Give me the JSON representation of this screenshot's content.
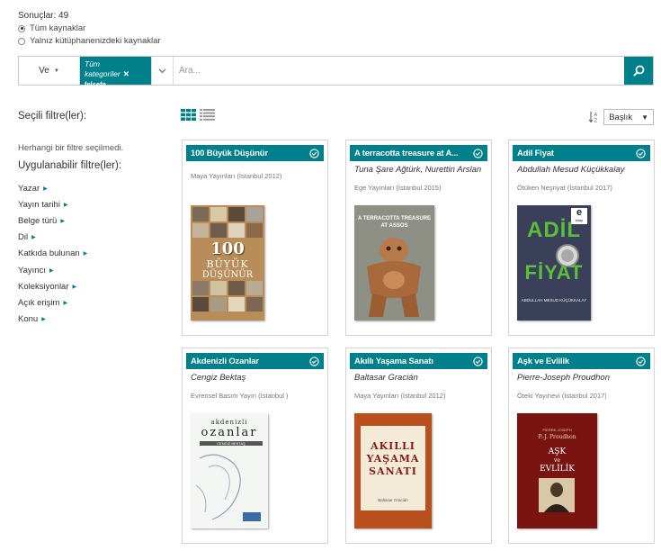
{
  "results": {
    "count_label": "Sonuçlar: 49",
    "scope_all": "Tüm kaynaklar",
    "scope_library": "Yalnız kütüphanenizdeki kaynaklar"
  },
  "search": {
    "operator": "Ve",
    "category_chip": "Tüm kategoriler",
    "category_sub": "felsefe",
    "placeholder": "Ara..."
  },
  "sidebar": {
    "selected_title": "Seçili filtre(ler):",
    "no_filter": "Herhangi bir filtre seçilmedi.",
    "applicable_title": "Uygulanabilir filtre(ler):",
    "filters": [
      "Yazar",
      "Yayın tarihi",
      "Belge türü",
      "Dil",
      "Katkıda bulunan",
      "Yayıncı",
      "Koleksiyonlar",
      "Açık erişim",
      "Konu"
    ]
  },
  "sort": {
    "selected": "Başlık"
  },
  "cards": [
    {
      "title": "100 Büyük Düşünür",
      "author": "",
      "publisher": "Maya Yayınları (İstanbul 2012)"
    },
    {
      "title": "A terracotta treasure at A...",
      "author": "Tuna Şare Ağtürk, Nurettin Arslan",
      "publisher": "Ege Yayınları (İstanbul 2015)"
    },
    {
      "title": "Adil Fiyat",
      "author": "Abdullah Mesud Küçükkalay",
      "publisher": "Ötüken Neşriyat (İstanbul 2017)"
    },
    {
      "title": "Akdenizli Ozanlar",
      "author": "Cengiz Bektaş",
      "publisher": "Evrensel Basım Yayın (İstanbul )"
    },
    {
      "title": "Akıllı Yaşama Sanatı",
      "author": "Baltasar Gracián",
      "publisher": "Maya Yayınları (İstanbul 2012)"
    },
    {
      "title": "Aşk ve Evlilik",
      "author": "Pierre-Joseph Proudhon",
      "publisher": "Öteki Yayınevi (İstanbul 2017)"
    }
  ],
  "covers": {
    "c1": {
      "line1": "100",
      "line2": "BÜYÜK",
      "line3": "DÜŞÜNÜR"
    },
    "c2": {
      "line1": "A TERRACOTTA TREASURE",
      "line2": "AT ASSOS"
    },
    "c3": {
      "line1": "ADİL",
      "line2": "FİYAT",
      "badge": "e",
      "badge_sub": "kitap",
      "author": "ABDULLAH MESUD KÜÇÜKKALAY"
    },
    "c4": {
      "line1": "akdenizli",
      "line2": "ozanlar",
      "line3": "CENGİZ BEKTAŞ"
    },
    "c5": {
      "line1": "AKILLI",
      "line2": "YAŞAMA",
      "line3": "SANATI",
      "author": "Baltasar Gracián"
    },
    "c6": {
      "line1": "PIERRE-JOSEPH",
      "line2": "P.-J. Proudhon",
      "line3": "AŞK",
      "line4": "ve",
      "line5": "EVLİLİK"
    }
  },
  "colors": {
    "accent": "#00808a"
  }
}
